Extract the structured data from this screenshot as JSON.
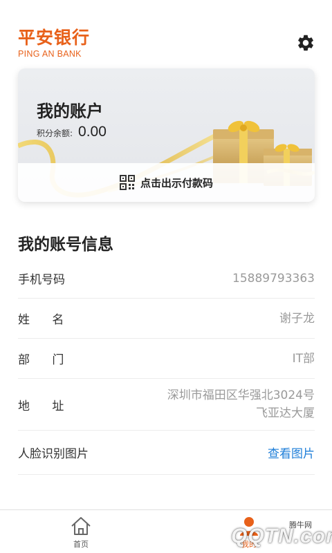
{
  "brand": {
    "name_cn": "平安银行",
    "name_en": "PING AN BANK",
    "color": "#e8611a"
  },
  "header": {
    "settings_icon": "gear-icon"
  },
  "account_card": {
    "title": "我的账户",
    "points_label": "积分余额:",
    "points_value": "0.00",
    "pay_code_label": "点击出示付款码",
    "pay_code_icon": "qr-code-icon"
  },
  "info_section": {
    "title": "我的账号信息",
    "rows": [
      {
        "label": "手机号码",
        "value": "15889793363"
      },
      {
        "label": "姓      名",
        "value": "谢子龙"
      },
      {
        "label": "部      门",
        "value": "IT部"
      },
      {
        "label": "地      址",
        "value_line1": "深圳市福田区华强北3024号",
        "value_line2": "飞亚达大厦"
      },
      {
        "label": "人脸识别图片",
        "link": "查看图片"
      }
    ],
    "link_color": "#1e7ed8"
  },
  "tabbar": {
    "home_label": "首页",
    "mine_label": "我的",
    "home_icon": "home-icon",
    "mine_icon": "user-icon"
  },
  "watermark": {
    "text": "QQTN.com",
    "small_text": "腾牛网"
  }
}
